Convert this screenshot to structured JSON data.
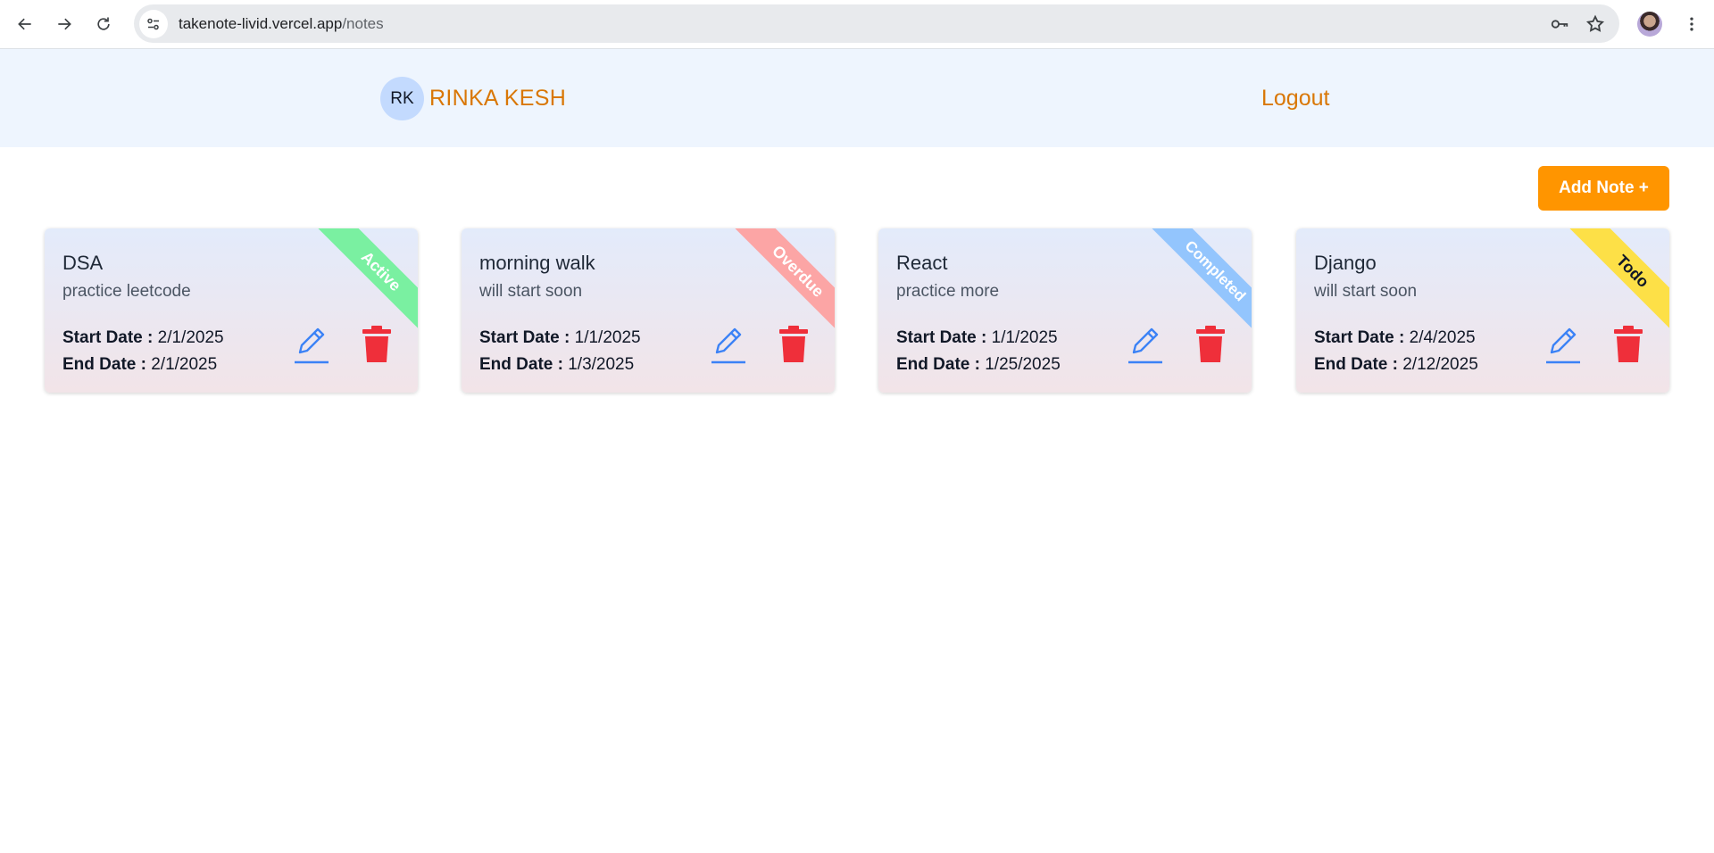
{
  "browser": {
    "url_host": "takenote-livid.vercel.app",
    "url_path": "/notes"
  },
  "header": {
    "avatar_initials": "RK",
    "user_name": "RINKA KESH",
    "logout_label": "Logout"
  },
  "add_note_label": "Add Note +",
  "labels": {
    "start_date": "Start Date :",
    "end_date": "End Date :"
  },
  "notes": [
    {
      "title": "DSA",
      "description": "practice leetcode",
      "start_date": "2/1/2025",
      "end_date": "2/1/2025",
      "status": "Active",
      "status_color": "#7af0a1",
      "status_text_color": "#ffffff"
    },
    {
      "title": "morning walk",
      "description": "will start soon",
      "start_date": "1/1/2025",
      "end_date": "1/3/2025",
      "status": "Overdue",
      "status_color": "#fca5a5",
      "status_text_color": "#ffffff"
    },
    {
      "title": "React",
      "description": "practice more",
      "start_date": "1/1/2025",
      "end_date": "1/25/2025",
      "status": "Completed",
      "status_color": "#93c5fd",
      "status_text_color": "#ffffff"
    },
    {
      "title": "Django",
      "description": "will start soon",
      "start_date": "2/4/2025",
      "end_date": "2/12/2025",
      "status": "Todo",
      "status_color": "#fde047",
      "status_text_color": "#111827"
    }
  ],
  "icons": {
    "edit": "pencil-icon",
    "delete": "trash-icon",
    "accent_blue": "#3b82f6",
    "accent_red": "#ef2f3a"
  }
}
